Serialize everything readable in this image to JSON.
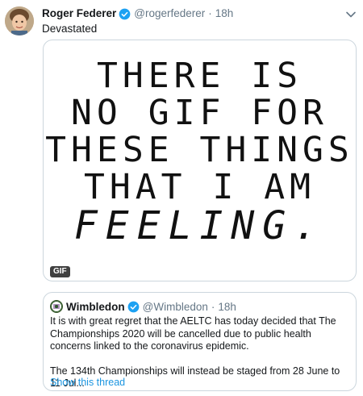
{
  "tweet": {
    "author_name": "Roger Federer",
    "handle": "@rogerfederer",
    "separator": "·",
    "time": "18h",
    "text": "Devastated"
  },
  "media": {
    "lines": [
      "THERE IS",
      "NO GIF FOR",
      "THESE THINGS",
      "THAT I AM",
      "FEELING."
    ],
    "badge": "GIF"
  },
  "quoted_tweet": {
    "author_name": "Wimbledon",
    "handle": "@Wimbledon",
    "separator": "·",
    "time": "18h",
    "paragraph_1": "It is with great regret that the AELTC has today decided that The Championships 2020 will be cancelled due to public health concerns linked to the coronavirus epidemic.",
    "paragraph_2": "The 134th Championships will instead be staged from 28 June to 11 Jul...",
    "show_thread": "Show this thread"
  },
  "colors": {
    "verified": "#1da1f2",
    "link": "#1b95e0",
    "muted": "#657786",
    "border": "#ccd6dd"
  },
  "icons": [
    "verified-badge-icon",
    "caret-down-icon",
    "avatar",
    "wimbledon-logo-icon"
  ]
}
